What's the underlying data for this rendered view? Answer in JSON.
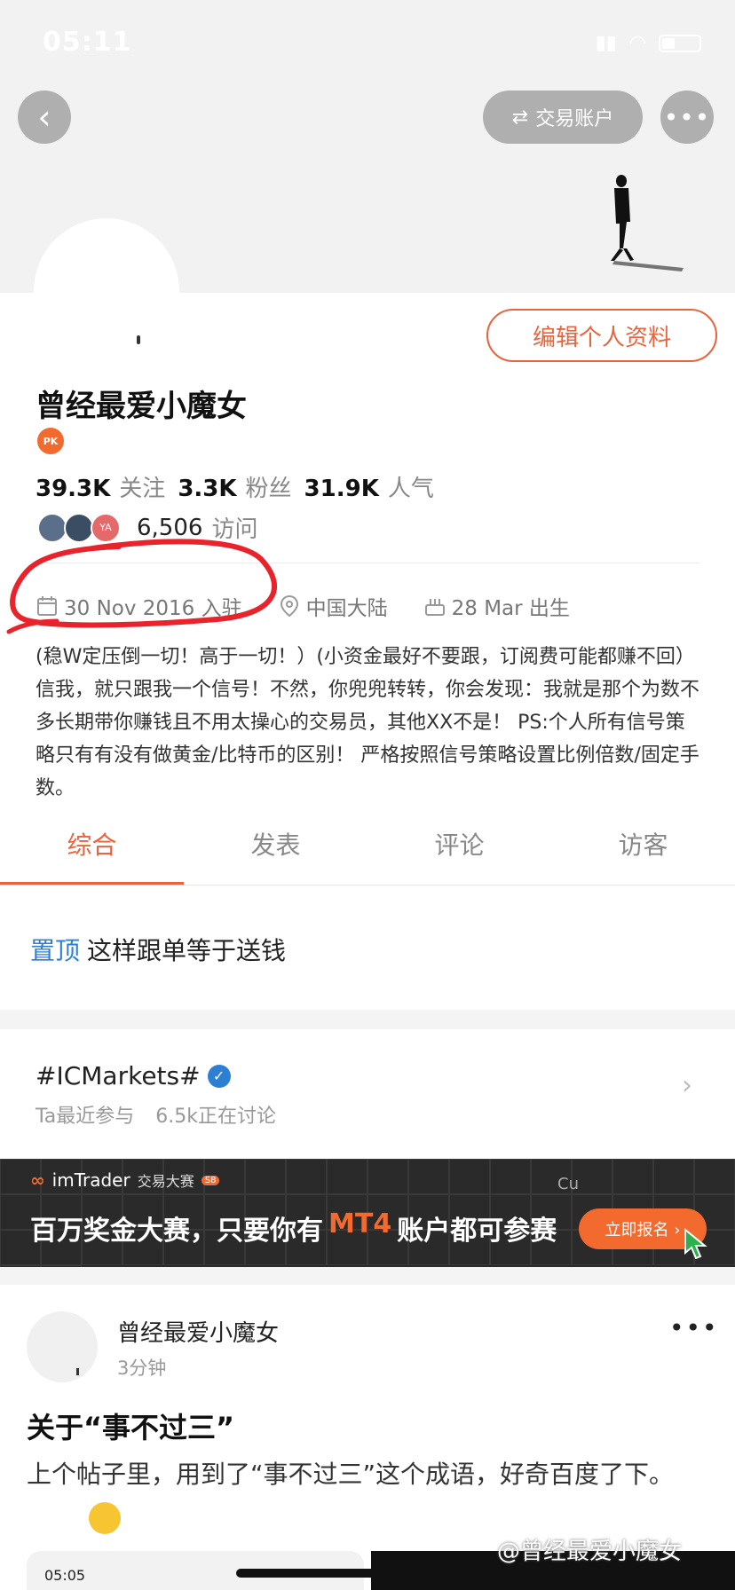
{
  "status_bar": {
    "time": "05:11"
  },
  "header": {
    "back_label": "‹",
    "account_button": "交易账户",
    "account_icon": "swap-arrows-icon",
    "more_label": "•••"
  },
  "profile": {
    "edit_button": "编辑个人资料",
    "name": "曾经最爱小魔女",
    "badge": "PK",
    "stats": [
      {
        "value": "39.3K",
        "label": "关注"
      },
      {
        "value": "3.3K",
        "label": "粉丝"
      },
      {
        "value": "31.9K",
        "label": "人气"
      }
    ],
    "visitor_avatars": [
      "#5b6f8a",
      "#3a4d63",
      "#e46a6a"
    ],
    "visitor_avatar_text": "YA",
    "visits_value": "6,506",
    "visits_label": "访问",
    "joined": "30 Nov 2016 入驻",
    "location": "中国大陆",
    "birthday": "28 Mar 出生",
    "bio": "(稳W定压倒一切！高于一切！）(小资金最好不要跟，订阅费可能都赚不回） 信我，就只跟我一个信号！不然，你兜兜转转，你会发现：我就是那个为数不多长期带你赚钱且不用太操心的交易员，其他XX不是！      PS:个人所有信号策略只有有没有做黄金/比特币的区别！   严格按照信号策略设置比例倍数/固定手数。"
  },
  "tabs": [
    "综合",
    "发表",
    "评论",
    "访客"
  ],
  "active_tab": 0,
  "pinned": {
    "tag": "置顶",
    "text": "这样跟单等于送钱"
  },
  "topic": {
    "title": "#ICMarkets#",
    "participated": "Ta最近参与",
    "discussing": "6.5k正在讨论"
  },
  "banner": {
    "brand": "imTrader",
    "event": "交易大赛",
    "season": "S8",
    "headline_before": "百万奖金大赛，只要你有",
    "headline_highlight": "MT4",
    "headline_after": "账户都可参赛",
    "cta": "立即报名 ›",
    "tile_text": "Cu"
  },
  "post": {
    "author": "曾经最爱小魔女",
    "time": "3分钟",
    "more": "•••",
    "title": "关于“事不过三”",
    "body": "上个帖子里，用到了“事不过三”这个成语，好奇百度了下。"
  },
  "thumbnail": {
    "time": "05:05"
  },
  "watermark": "@曾经最爱小魔女",
  "colors": {
    "accent": "#e8643d",
    "link": "#2d7fd3",
    "annotation": "#e8232b"
  }
}
